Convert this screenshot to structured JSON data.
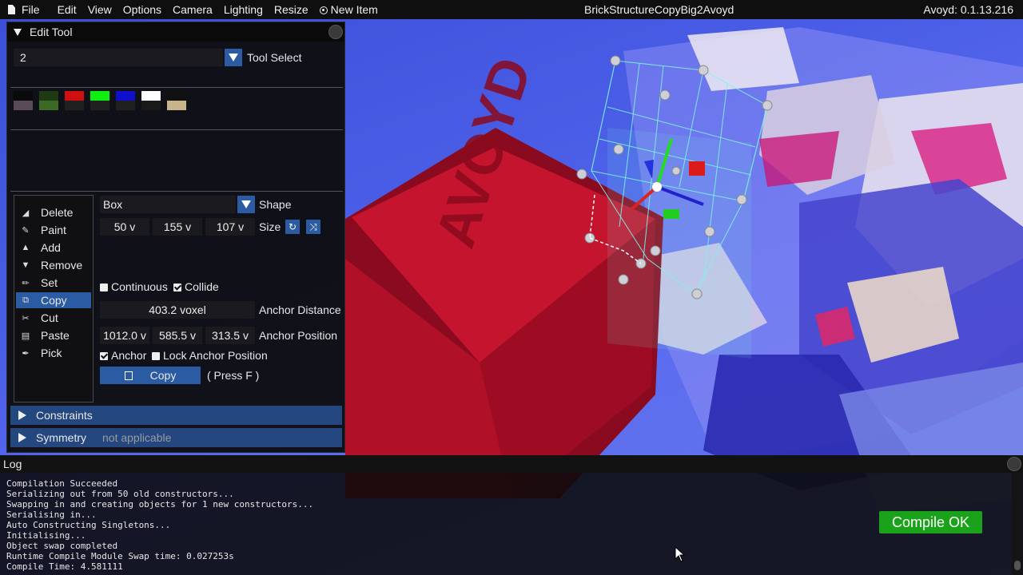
{
  "menubar": {
    "items": [
      "File",
      "Edit",
      "View",
      "Options",
      "Camera",
      "Lighting",
      "Resize",
      "New Item"
    ],
    "window_title": "BrickStructureCopyBig2Avoyd",
    "version": "Avoyd: 0.1.13.216"
  },
  "edit_tool": {
    "title": "Edit Tool",
    "tool_select": {
      "value": "2",
      "label": "Tool Select"
    },
    "swatches": [
      {
        "top": "#0a0a0a",
        "bottom": "#5a4a55"
      },
      {
        "top": "#1e3a12",
        "bottom": "#3c6a24"
      },
      {
        "top": "#d01010",
        "bottom": "#202020"
      },
      {
        "top": "#10ee10",
        "bottom": "#202020"
      },
      {
        "top": "#1010cc",
        "bottom": "#202020"
      },
      {
        "top": "#ffffff",
        "bottom": "#1a1a1a"
      },
      {
        "top": "#111111",
        "bottom": "#c8b48a"
      }
    ],
    "tools": [
      {
        "label": "Delete",
        "icon": "eraser-icon",
        "glyph": "◢"
      },
      {
        "label": "Paint",
        "icon": "brush-icon",
        "glyph": "✎"
      },
      {
        "label": "Add",
        "icon": "caret-up-icon",
        "glyph": "▲"
      },
      {
        "label": "Remove",
        "icon": "caret-down-icon",
        "glyph": "▼"
      },
      {
        "label": "Set",
        "icon": "pencil-icon",
        "glyph": "✏"
      },
      {
        "label": "Copy",
        "icon": "copy-icon",
        "glyph": "⧉"
      },
      {
        "label": "Cut",
        "icon": "scissors-icon",
        "glyph": "✂"
      },
      {
        "label": "Paste",
        "icon": "clipboard-icon",
        "glyph": "▤"
      },
      {
        "label": "Pick",
        "icon": "eyedropper-icon",
        "glyph": "✒"
      }
    ],
    "selected_tool": "Copy",
    "shape": {
      "value": "Box",
      "label": "Shape"
    },
    "size": {
      "x": "50 v",
      "y": "155 v",
      "z": "107 v",
      "label": "Size"
    },
    "continuous": {
      "label": "Continuous",
      "checked": false
    },
    "collide": {
      "label": "Collide",
      "checked": true
    },
    "anchor_distance": {
      "value": "403.2 voxel",
      "label": "Anchor Distance"
    },
    "anchor_position": {
      "x": "1012.0 v",
      "y": "585.5 v",
      "z": "313.5 v",
      "label": "Anchor Position"
    },
    "anchor": {
      "label": "Anchor",
      "checked": true
    },
    "lock_anchor": {
      "label": "Lock Anchor Position",
      "checked": false
    },
    "copy_button": {
      "label": "Copy",
      "hint": "( Press F )"
    },
    "constraints": {
      "label": "Constraints"
    },
    "symmetry": {
      "label": "Symmetry",
      "note": "not applicable"
    }
  },
  "log": {
    "title": "Log",
    "lines": [
      "Compilation Succeeded",
      "Serializing out from 50 old constructors...",
      "Swapping in and creating objects for 1 new constructors...",
      "Serialising in...",
      "Auto Constructing Singletons...",
      "Initialising...",
      "Object swap completed",
      "Runtime Compile Module Swap time: 0.027253s",
      "Compile Time: 4.581111"
    ],
    "status_badge": "Compile OK"
  },
  "colors": {
    "accent": "#2b5ba3",
    "success": "#1aa31a",
    "sky": "#4a5de6",
    "cube_red": "#c2122e"
  }
}
